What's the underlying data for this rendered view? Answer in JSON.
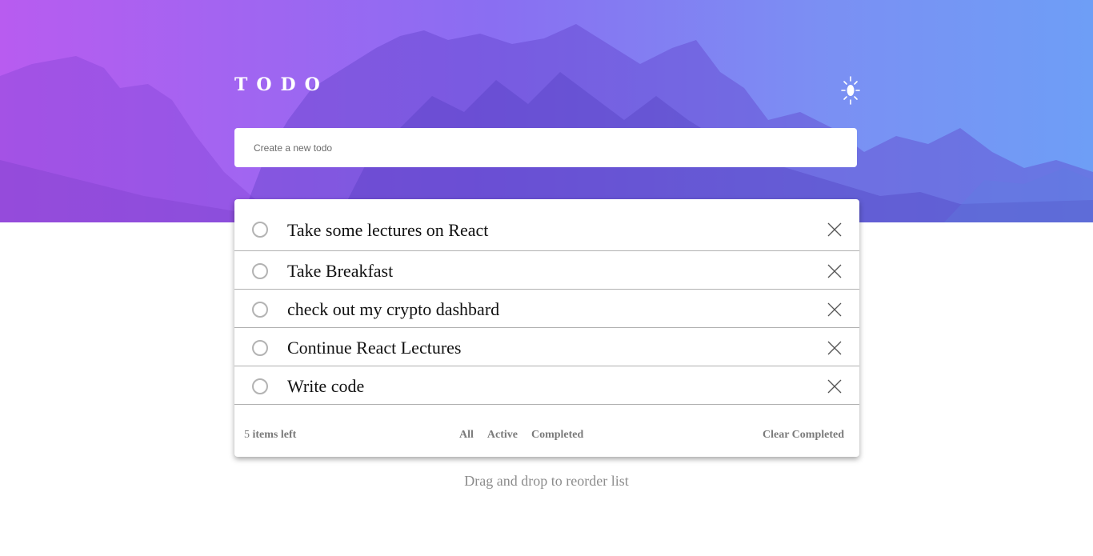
{
  "header": {
    "title": "TODO",
    "theme_icon": "sun-icon"
  },
  "new_todo": {
    "placeholder": "Create a new todo",
    "value": ""
  },
  "todos": [
    {
      "text": "Take some lectures on React",
      "completed": false
    },
    {
      "text": "Take Breakfast",
      "completed": false
    },
    {
      "text": "check out my crypto dashbard",
      "completed": false
    },
    {
      "text": "Continue React Lectures",
      "completed": false
    },
    {
      "text": "Write code",
      "completed": false
    }
  ],
  "footer": {
    "count": "5",
    "count_suffix": "items left",
    "filters": {
      "all": "All",
      "active": "Active",
      "completed": "Completed"
    },
    "clear_completed": "Clear Completed"
  },
  "hint": "Drag and drop to reorder list",
  "colors": {
    "gradient_start": "#b85cf0",
    "gradient_end": "#6e9ef6",
    "text_muted": "#7a7a7a"
  }
}
